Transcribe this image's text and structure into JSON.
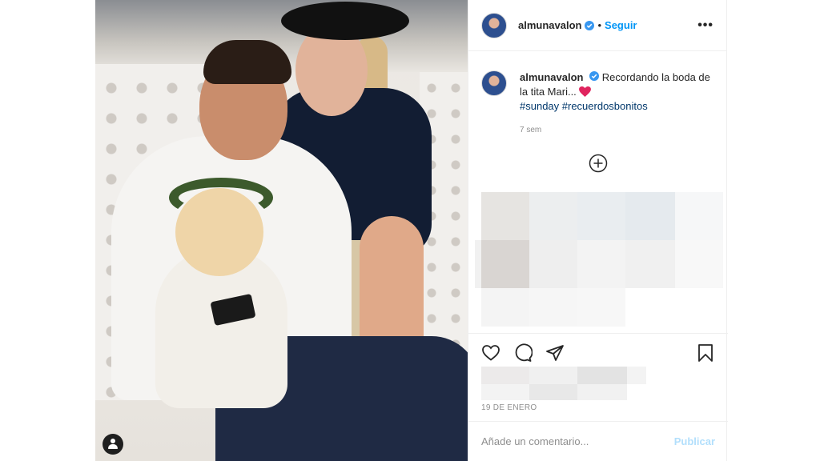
{
  "post": {
    "username": "almunavalon",
    "follow_label": "Seguir",
    "separator": "•",
    "more_label": "•••",
    "caption_text": "Recordando la boda de la tita Mari... ",
    "hashtags": "#sunday #recuerdosbonitos",
    "caption_time": "7 sem",
    "date": "19 DE ENERO",
    "comment_placeholder": "Añade un comentario...",
    "publish_label": "Publicar"
  },
  "colors": {
    "accent": "#0095f6",
    "publish_disabled": "#b2dffc",
    "hashtag": "#00376b",
    "muted": "#8e8e8e",
    "border": "#efefef"
  },
  "icons": {
    "verified": "verified-badge-icon",
    "heart_emoji": "red-heart-emoji",
    "add": "plus-circle-icon",
    "like": "heart-outline-icon",
    "comment": "speech-bubble-icon",
    "share": "paper-plane-icon",
    "save": "bookmark-icon",
    "photo_tag": "person-tag-icon"
  }
}
